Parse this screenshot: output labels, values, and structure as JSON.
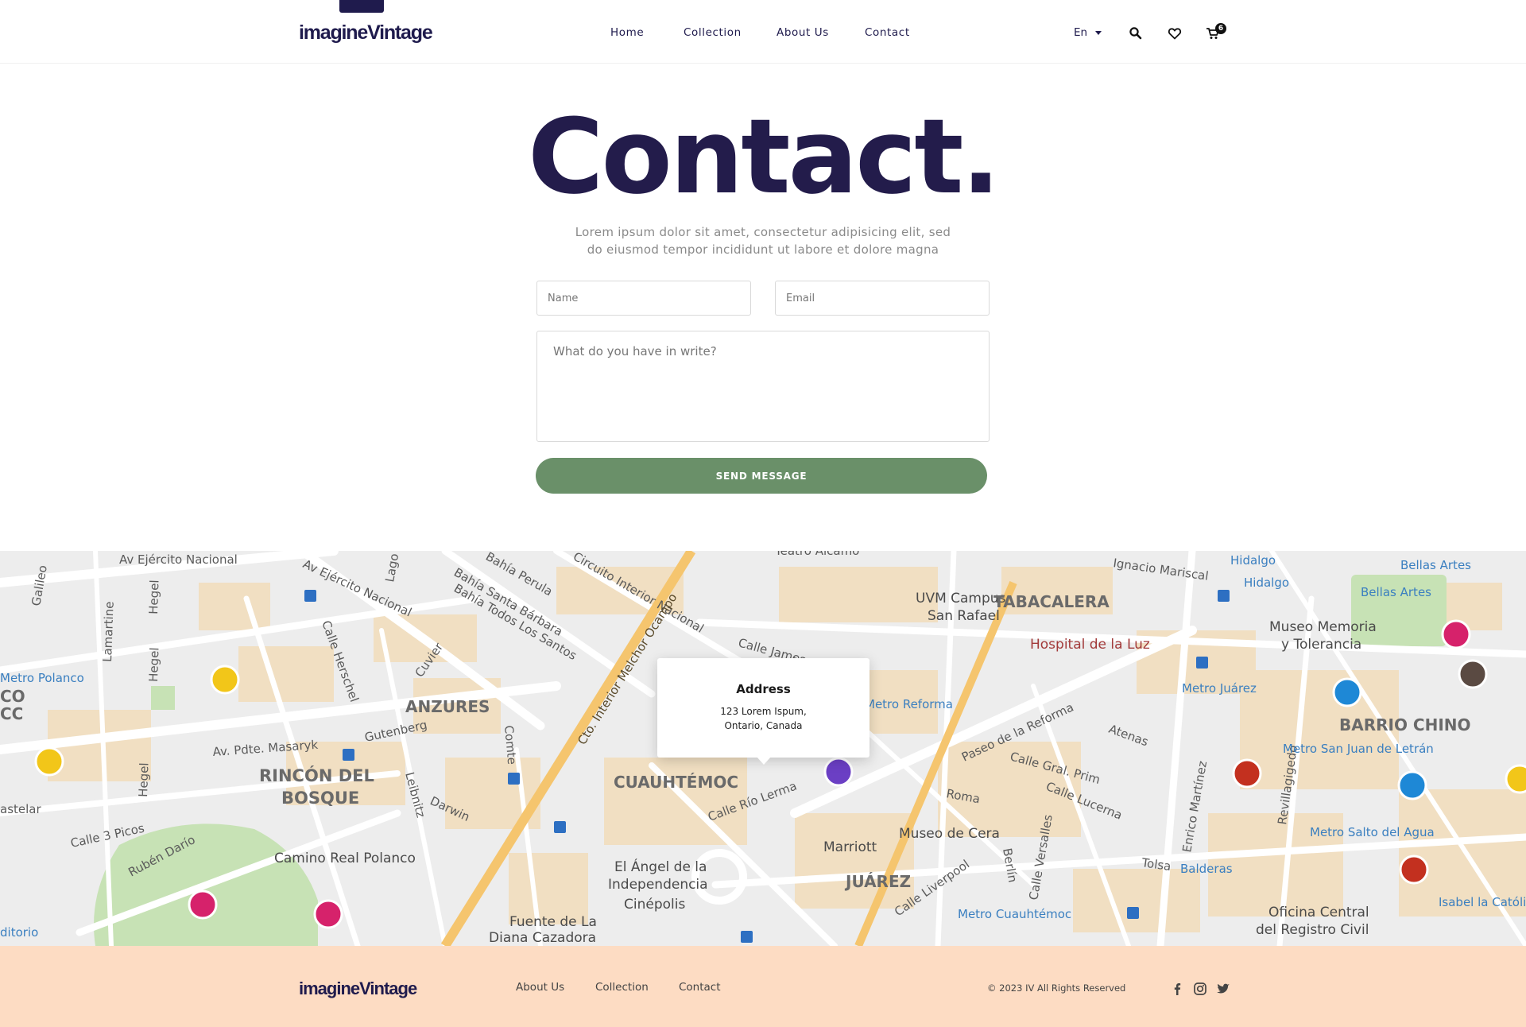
{
  "header": {
    "logo_prefix": "imagine",
    "logo_suffix": "Vintage",
    "nav": [
      "Home",
      "Collection",
      "About Us",
      "Contact"
    ],
    "language": "En",
    "cart_count": "6",
    "icons": [
      "search-icon",
      "heart-icon",
      "cart-icon"
    ]
  },
  "hero": {
    "title": "Contact.",
    "subtitle_line1": "Lorem ipsum dolor sit amet, consectetur adipisicing elit, sed",
    "subtitle_line2": "do eiusmod tempor incididunt ut labore et dolore magna"
  },
  "form": {
    "name_placeholder": "Name",
    "email_placeholder": "Email",
    "message_placeholder": "What do you have in write?",
    "send_label": "SEND MESSAGE",
    "button_color": "#6a9069"
  },
  "map": {
    "popup_title": "Address",
    "popup_line1": "123 Lorem Ispum,",
    "popup_line2": "Ontario, Canada",
    "labels": [
      "Av Ejército Nacional",
      "Av Ejército Nacional",
      "Lago",
      "Bahía Santa Bárbara",
      "Bahía Perula",
      "Bahía Todos Los Santos",
      "Circuito Interior Nacional",
      "Galileo",
      "Lamartine",
      "Hegel",
      "Hegel",
      "Hegel",
      "Metro Polanco",
      "Calle Herschel",
      "Cuvier",
      "ANZURES",
      "Gutenberg",
      "Av. Pdte. Masaryk",
      "RINCÓN DEL",
      "BOSQUE",
      "Leibnitz",
      "Darwin",
      "Comte",
      "Calle 3 Picos",
      "Rubén Darío",
      "Camino Real Polanco",
      "astelar",
      "CO",
      "CC",
      "ditorio",
      "Cto. Interior Melchor Ocampo",
      "CUAUHTÉMOC",
      "Calle Río Lerma",
      "Calle James",
      "Teatro Alcamo",
      "El Ángel de la",
      "Independencia",
      "Cinépolis",
      "Fuente de La",
      "Diana Cazadora",
      "UVM Campus",
      "San Rafael",
      "TABACALERA",
      "Hospital de la Luz",
      "Ignacio Mariscal",
      "Hidalgo",
      "Hidalgo",
      "Bellas Artes",
      "Bellas Artes",
      "Museo Memoria",
      "y Tolerancia",
      "Metro Juárez",
      "Metro Reforma",
      "Paseo de la Reforma",
      "Atenas",
      "Calle Gral. Prim",
      "Calle Lucerna",
      "Roma",
      "Museo de Cera",
      "Marriott",
      "JUÁREZ",
      "Calle Liverpool",
      "Metro Cuauhtémoc",
      "Berlín",
      "Calle Versalles",
      "Enrico Martínez",
      "Tolsa",
      "Balderas",
      "Revillagigedo",
      "BARRIO CHINO",
      "Metro San Juan de Letrán",
      "Metro Salto del Agua",
      "Oficina Central",
      "del Registro Civil",
      "Isabel la Católica"
    ]
  },
  "footer": {
    "logo_prefix": "imagine",
    "logo_suffix": "Vintage",
    "links": [
      "About Us",
      "Collection",
      "Contact"
    ],
    "copyright": "© 2023 IV All Rights Reserved",
    "social": [
      "facebook-icon",
      "instagram-icon",
      "twitter-icon"
    ],
    "background": "#fddcc3"
  },
  "colors": {
    "brand": "#1f1b4d",
    "accent": "#6a9069"
  }
}
